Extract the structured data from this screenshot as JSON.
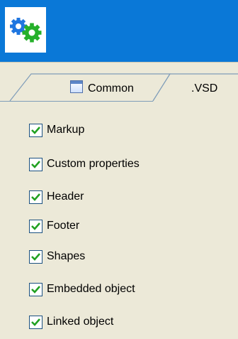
{
  "app_icon": "gears-icon",
  "tabs": [
    {
      "label": "Common",
      "icon": "window-icon",
      "active": false
    },
    {
      "label": ".VSD",
      "active": true
    }
  ],
  "options": [
    {
      "label": "Markup",
      "checked": true
    },
    {
      "label": "Custom properties",
      "checked": true
    },
    {
      "label": "Header",
      "checked": true
    },
    {
      "label": "Footer",
      "checked": true
    },
    {
      "label": "Shapes",
      "checked": true
    },
    {
      "label": "Embedded object",
      "checked": true
    },
    {
      "label": "Linked object",
      "checked": true
    }
  ],
  "colors": {
    "header_blue": "#0a78d7",
    "panel_bg": "#ece9d8",
    "check_green": "#21a121",
    "checkbox_border": "#1c5180"
  }
}
